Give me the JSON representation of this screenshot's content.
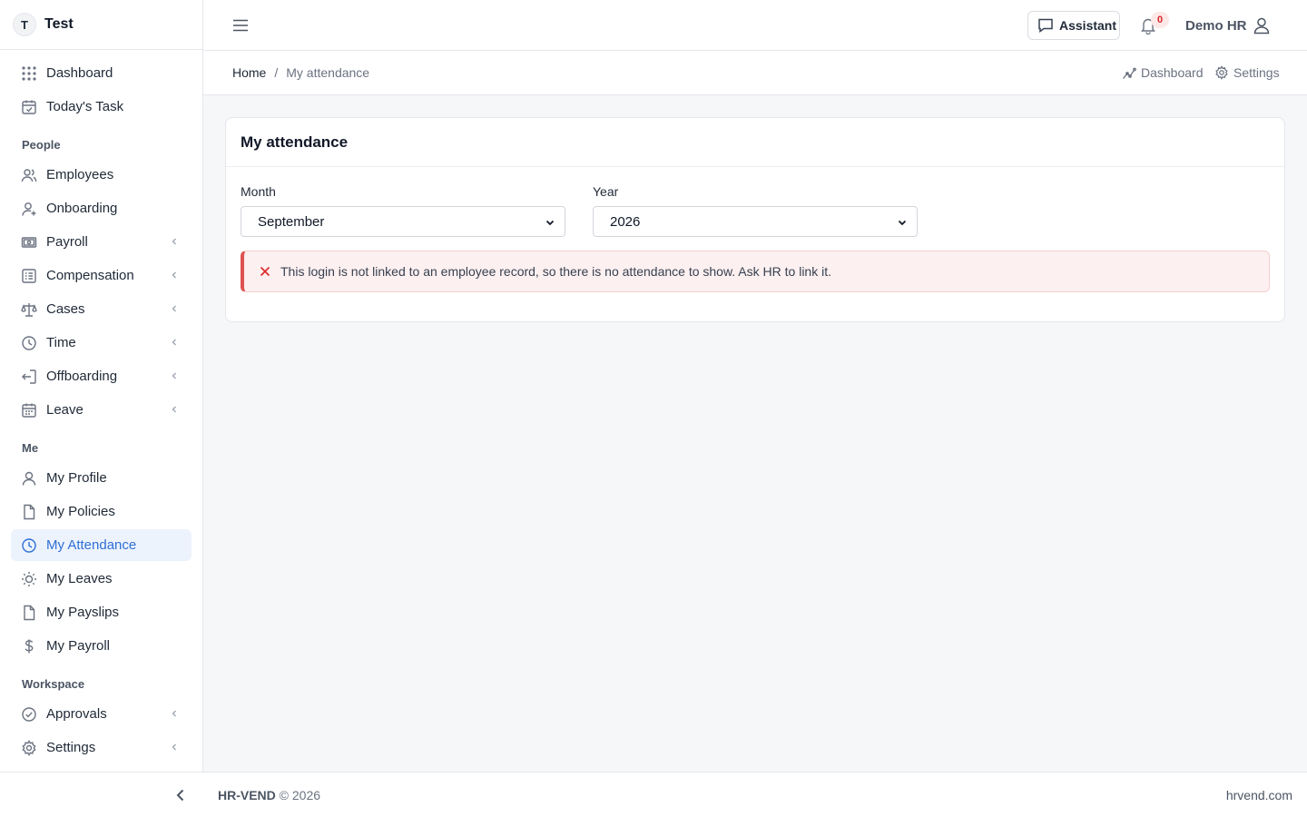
{
  "brand": {
    "initial": "T",
    "name": "Test"
  },
  "sidebar": {
    "top": [
      {
        "label": "Dashboard",
        "icon": "grid-icon"
      },
      {
        "label": "Today's Task",
        "icon": "calendar-check-icon"
      }
    ],
    "people_label": "People",
    "people": [
      {
        "label": "Employees",
        "icon": "users-icon",
        "has_submenu": false
      },
      {
        "label": "Onboarding",
        "icon": "user-plus-icon",
        "has_submenu": false
      },
      {
        "label": "Payroll",
        "icon": "money-icon",
        "has_submenu": true
      },
      {
        "label": "Compensation",
        "icon": "list-icon",
        "has_submenu": true
      },
      {
        "label": "Cases",
        "icon": "scale-icon",
        "has_submenu": true
      },
      {
        "label": "Time",
        "icon": "clock-icon",
        "has_submenu": true
      },
      {
        "label": "Offboarding",
        "icon": "logout-icon",
        "has_submenu": true
      },
      {
        "label": "Leave",
        "icon": "calendar-icon",
        "has_submenu": true
      }
    ],
    "me_label": "Me",
    "me": [
      {
        "label": "My Profile",
        "icon": "user-icon"
      },
      {
        "label": "My Policies",
        "icon": "file-icon"
      },
      {
        "label": "My Attendance",
        "icon": "clock-icon",
        "active": true
      },
      {
        "label": "My Leaves",
        "icon": "sun-icon"
      },
      {
        "label": "My Payslips",
        "icon": "file-icon"
      },
      {
        "label": "My Payroll",
        "icon": "dollar-icon"
      }
    ],
    "workspace_label": "Workspace",
    "workspace": [
      {
        "label": "Approvals",
        "icon": "check-circle-icon",
        "has_submenu": true
      },
      {
        "label": "Settings",
        "icon": "gear-icon",
        "has_submenu": true
      }
    ]
  },
  "topbar": {
    "assistant_label": "Assistant",
    "notification_count": "0",
    "user_name": "Demo HR"
  },
  "breadcrumb": {
    "home": "Home",
    "separator": "/",
    "current": "My attendance",
    "quick_dashboard": "Dashboard",
    "quick_settings": "Settings"
  },
  "card": {
    "title": "My attendance",
    "month_label": "Month",
    "month_value": "September",
    "year_label": "Year",
    "year_value": "2026",
    "alert_text": "This login is not linked to an employee record, so there is no attendance to show. Ask HR to link it."
  },
  "footer": {
    "brand": "HR-VEND",
    "copyright": "© 2026",
    "site": "hrvend.com"
  },
  "colors": {
    "accent": "#2f6fd6",
    "danger": "#dc2626",
    "alert_bg": "#fdf0f0"
  }
}
